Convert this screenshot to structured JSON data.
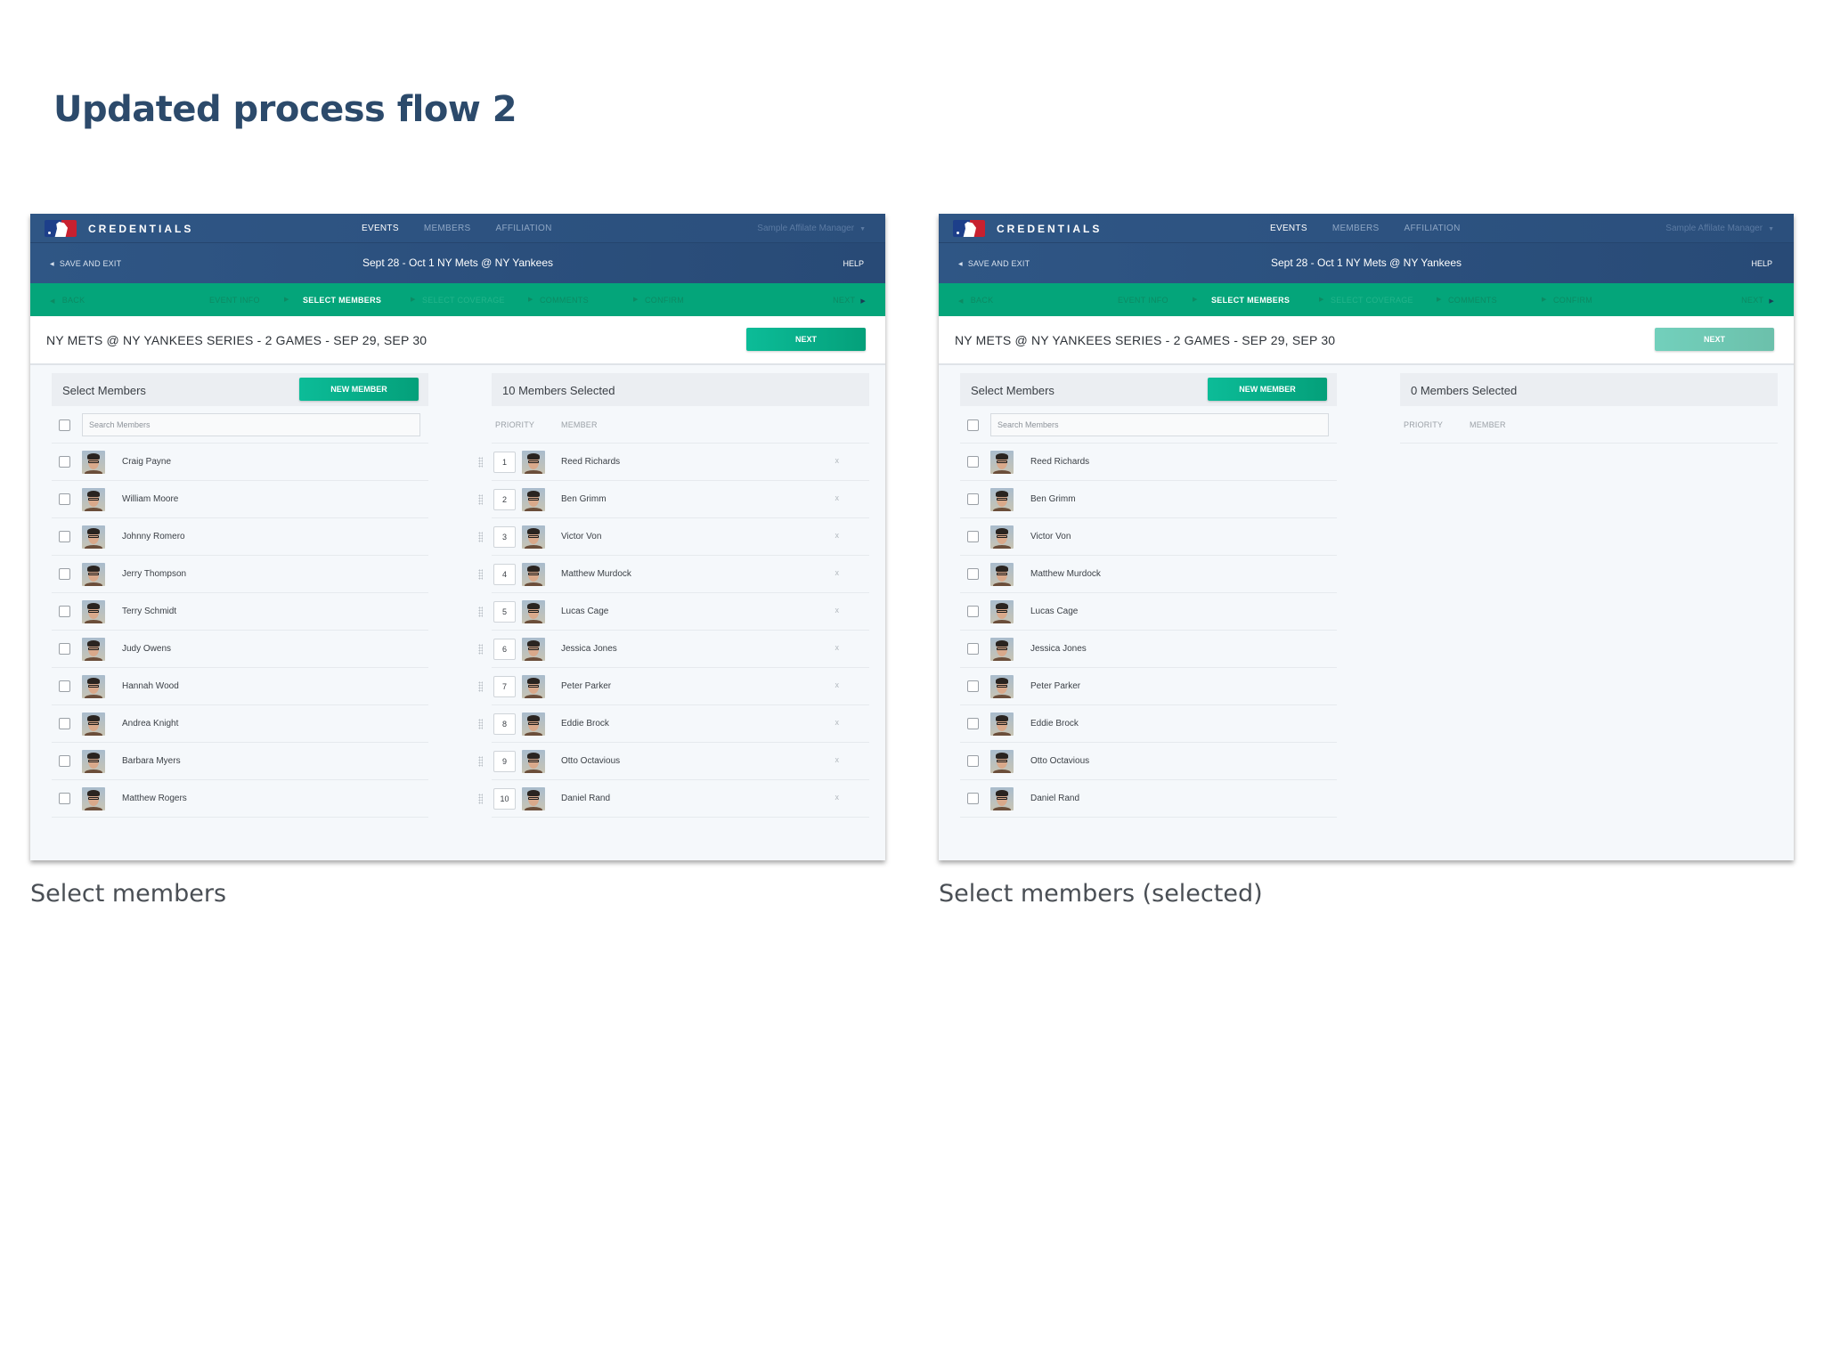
{
  "page_title": "Updated process flow 2",
  "colors": {
    "title": "#2c4a6b",
    "nav_bg": "#2f5685",
    "steps_bg": "#04a57a",
    "accent_button": "#0cbc98",
    "accent_button_disabled": "#72d0bc",
    "panel_bg": "#f5f8fb"
  },
  "screens": [
    {
      "caption": "Select members",
      "nav": {
        "brand": "CREDENTIALS",
        "logo_icon": "mlb-logo",
        "links": [
          "EVENTS",
          "MEMBERS",
          "AFFILIATION"
        ],
        "active_link": "EVENTS",
        "user": "Sample Affilate Manager"
      },
      "subbar": {
        "save_exit": "SAVE AND EXIT",
        "event_title": "Sept 28 - Oct 1 NY Mets @ NY Yankees",
        "help": "HELP"
      },
      "steps": {
        "back": "BACK",
        "items": [
          "EVENT INFO",
          "SELECT MEMBERS",
          "SELECT COVERAGE",
          "COMMENTS",
          "CONFIRM"
        ],
        "current": "SELECT MEMBERS",
        "next": "NEXT"
      },
      "series_title": "NY METS @ NY YANKEES SERIES - 2 GAMES - SEP 29, SEP 30",
      "next_button": "NEXT",
      "next_enabled": true,
      "select_panel": {
        "title": "Select Members",
        "new_member_button": "NEW MEMBER",
        "search_placeholder": "Search Members",
        "members": [
          "Craig Payne",
          "William Moore",
          "Johnny Romero",
          "Jerry Thompson",
          "Terry Schmidt",
          "Judy Owens",
          "Hannah Wood",
          "Andrea Knight",
          "Barbara Myers",
          "Matthew Rogers"
        ]
      },
      "selected_panel": {
        "title": "10 Members Selected",
        "col_priority": "PRIORITY",
        "col_member": "MEMBER",
        "remove_label": "x",
        "members": [
          {
            "priority": "1",
            "name": "Reed Richards"
          },
          {
            "priority": "2",
            "name": "Ben Grimm"
          },
          {
            "priority": "3",
            "name": "Victor Von"
          },
          {
            "priority": "4",
            "name": "Matthew Murdock"
          },
          {
            "priority": "5",
            "name": "Lucas Cage"
          },
          {
            "priority": "6",
            "name": "Jessica Jones"
          },
          {
            "priority": "7",
            "name": "Peter Parker"
          },
          {
            "priority": "8",
            "name": "Eddie Brock"
          },
          {
            "priority": "9",
            "name": "Otto Octavious"
          },
          {
            "priority": "10",
            "name": "Daniel Rand"
          }
        ]
      }
    },
    {
      "caption": "Select members (selected)",
      "nav": {
        "brand": "CREDENTIALS",
        "logo_icon": "mlb-logo",
        "links": [
          "EVENTS",
          "MEMBERS",
          "AFFILIATION"
        ],
        "active_link": "EVENTS",
        "user": "Sample Affilate Manager"
      },
      "subbar": {
        "save_exit": "SAVE AND EXIT",
        "event_title": "Sept 28 - Oct 1 NY Mets @ NY Yankees",
        "help": "HELP"
      },
      "steps": {
        "back": "BACK",
        "items": [
          "EVENT INFO",
          "SELECT MEMBERS",
          "SELECT COVERAGE",
          "COMMENTS",
          "CONFIRM"
        ],
        "current": "SELECT MEMBERS",
        "next": "NEXT"
      },
      "series_title": "NY METS @ NY YANKEES SERIES - 2 GAMES - SEP 29, SEP 30",
      "next_button": "NEXT",
      "next_enabled": false,
      "select_panel": {
        "title": "Select Members",
        "new_member_button": "NEW MEMBER",
        "search_placeholder": "Search Members",
        "members": [
          "Reed Richards",
          "Ben Grimm",
          "Victor Von",
          "Matthew Murdock",
          "Lucas Cage",
          "Jessica Jones",
          "Peter Parker",
          "Eddie Brock",
          "Otto Octavious",
          "Daniel Rand"
        ]
      },
      "selected_panel": {
        "title": "0 Members Selected",
        "col_priority": "PRIORITY",
        "col_member": "MEMBER",
        "remove_label": "x",
        "members": []
      }
    }
  ]
}
